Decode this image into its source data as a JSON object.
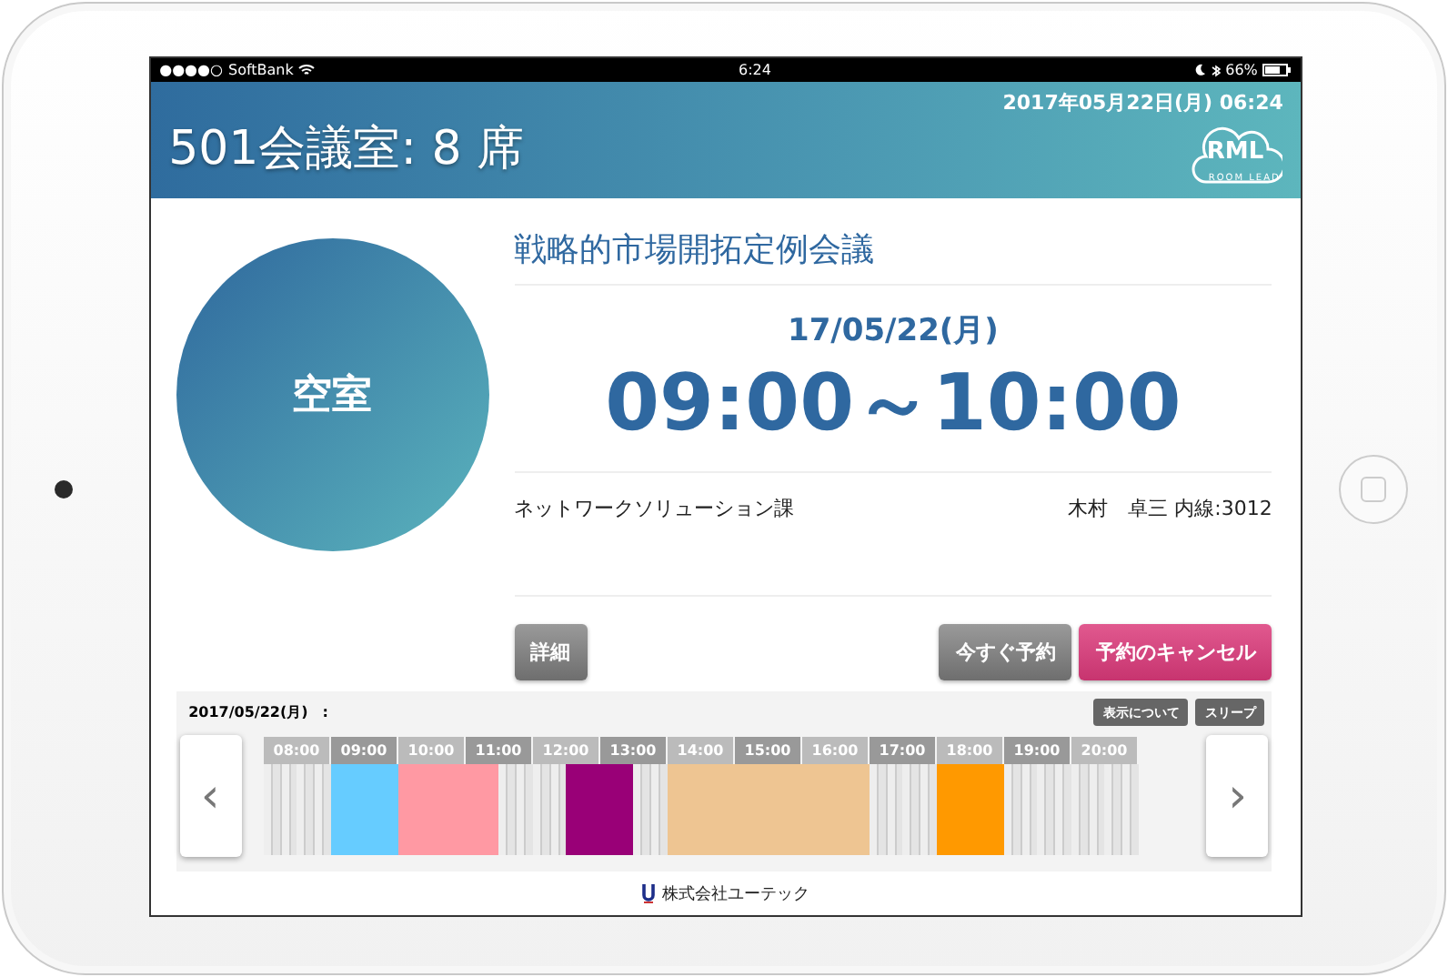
{
  "status_bar": {
    "signal": "●●●●○",
    "carrier": "SoftBank",
    "time": "6:24",
    "battery": "66%"
  },
  "header": {
    "room": "501会議室: 8 席",
    "datetime": "2017年05月22日(月) 06:24",
    "logo": {
      "mark": "RML",
      "caption": "ROOM LEAD"
    }
  },
  "status": {
    "label": "空室"
  },
  "meeting": {
    "title": "戦略的市場開拓定例会議",
    "date": "17/05/22(月)",
    "time": "09:00～10:00",
    "department": "ネットワークソリューション課",
    "organizer": "木村　卓三 内線:3012"
  },
  "buttons": {
    "details": "詳細",
    "book_now": "今すぐ予約",
    "cancel": "予約のキャンセル"
  },
  "timeline": {
    "date": "2017/05/22(月)　:",
    "buttons": [
      "表示について",
      "スリープ"
    ],
    "prev": "‹",
    "next": "›",
    "hours": [
      {
        "label": "08:00",
        "slots": [
          {
            "booked": false
          },
          {
            "booked": false
          }
        ]
      },
      {
        "label": "09:00",
        "slots": [
          {
            "booked": true,
            "color": "#66ccff"
          },
          {
            "booked": true,
            "color": "#66ccff"
          }
        ]
      },
      {
        "label": "10:00",
        "slots": [
          {
            "booked": true,
            "color": "#ff99a3"
          },
          {
            "booked": true,
            "color": "#ff99a3"
          }
        ]
      },
      {
        "label": "11:00",
        "slots": [
          {
            "booked": true,
            "color": "#ff99a3"
          },
          {
            "booked": false
          }
        ]
      },
      {
        "label": "12:00",
        "slots": [
          {
            "booked": false
          },
          {
            "booked": true,
            "color": "#990077"
          }
        ]
      },
      {
        "label": "13:00",
        "slots": [
          {
            "booked": true,
            "color": "#990077"
          },
          {
            "booked": false
          }
        ]
      },
      {
        "label": "14:00",
        "slots": [
          {
            "booked": true,
            "color": "#eec592"
          },
          {
            "booked": true,
            "color": "#eec592"
          }
        ]
      },
      {
        "label": "15:00",
        "slots": [
          {
            "booked": true,
            "color": "#eec592"
          },
          {
            "booked": true,
            "color": "#eec592"
          }
        ]
      },
      {
        "label": "16:00",
        "slots": [
          {
            "booked": true,
            "color": "#eec592"
          },
          {
            "booked": true,
            "color": "#eec592"
          }
        ]
      },
      {
        "label": "17:00",
        "slots": [
          {
            "booked": false
          },
          {
            "booked": false
          }
        ]
      },
      {
        "label": "18:00",
        "slots": [
          {
            "booked": true,
            "color": "#ff9900"
          },
          {
            "booked": true,
            "color": "#ff9900"
          }
        ]
      },
      {
        "label": "19:00",
        "slots": [
          {
            "booked": false
          },
          {
            "booked": false
          }
        ]
      },
      {
        "label": "20:00",
        "slots": [
          {
            "booked": false
          },
          {
            "booked": false
          }
        ]
      }
    ]
  },
  "footer": {
    "company": "株式会社ユーテック"
  }
}
